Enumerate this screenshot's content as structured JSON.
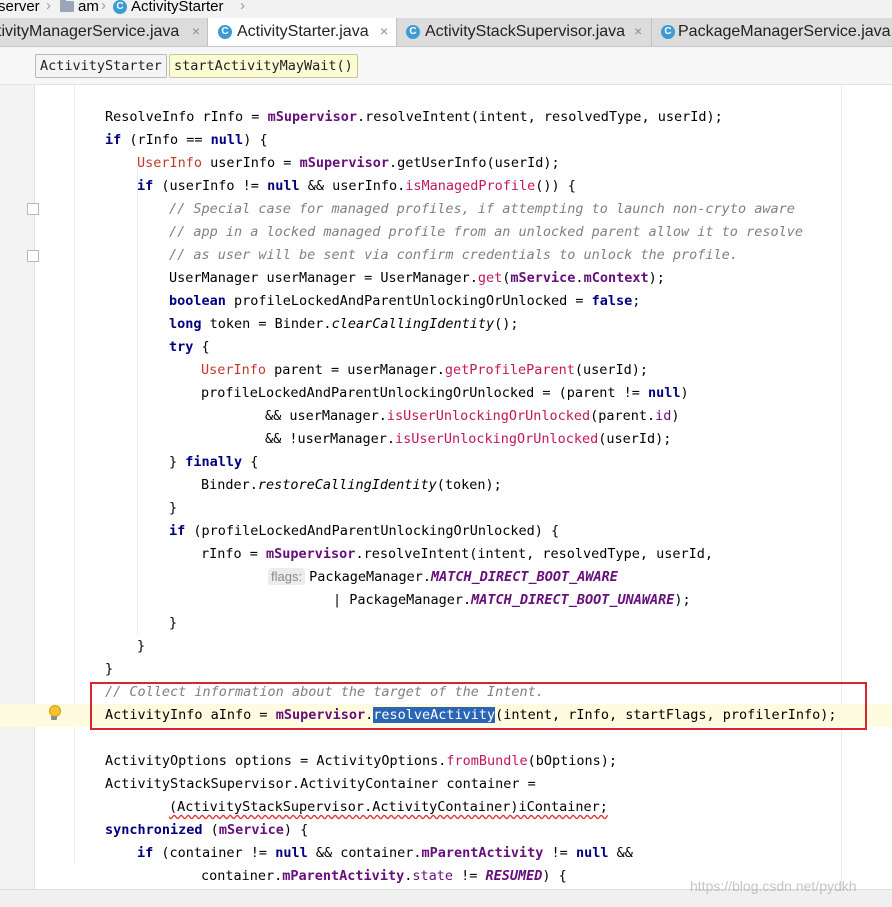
{
  "breadcrumbs": [
    "server",
    "am",
    "ActivityStarter"
  ],
  "tabs": [
    {
      "label": "tivityManagerService.java",
      "close": "×"
    },
    {
      "label": "ActivityStarter.java",
      "close": "×",
      "active": true
    },
    {
      "label": "ActivityStackSupervisor.java",
      "close": "×"
    },
    {
      "label": "PackageManagerService.java",
      "close": "×"
    }
  ],
  "nav": {
    "class_name": "ActivityStarter",
    "method_name": "startActivityMayWait()"
  },
  "code": {
    "l1": {
      "a": "ResolveInfo rInfo = ",
      "b": "mSupervisor",
      "c": ".resolveIntent(intent, resolvedType, userId);"
    },
    "l2": {
      "kw1": "if",
      "a": " (rInfo == ",
      "kw2": "null",
      "b": ") {"
    },
    "l3": {
      "cls": "UserInfo",
      "a": " userInfo = ",
      "f": "mSupervisor",
      "b": ".getUserInfo(userId);"
    },
    "l4": {
      "kw1": "if",
      "a": " (userInfo != ",
      "kw2": "null",
      "b": " && userInfo.",
      "m": "isManagedProfile",
      "c": "()) {"
    },
    "l5": "// Special case for managed profiles, if attempting to launch non-cryto aware",
    "l6": "// app in a locked managed profile from an unlocked parent allow it to resolve",
    "l7": "// as user will be sent via confirm credentials to unlock the profile.",
    "l8": {
      "a": "UserManager userManager = UserManager.",
      "m": "get",
      "b": "(",
      "f": "mService",
      "c": ".",
      "f2": "mContext",
      "d": ");"
    },
    "l9": {
      "kw": "boolean",
      "a": " profileLockedAndParentUnlockingOrUnlocked = ",
      "kw2": "false",
      "b": ";"
    },
    "l10": {
      "kw": "long",
      "a": " token = Binder.",
      "s": "clearCallingIdentity",
      "b": "();"
    },
    "l11": {
      "kw": "try",
      "a": " {"
    },
    "l12": {
      "cls": "UserInfo",
      "a": " parent = userManager.",
      "m": "getProfileParent",
      "b": "(userId);"
    },
    "l13": {
      "a": "profileLockedAndParentUnlockingOrUnlocked = (parent != ",
      "kw": "null",
      "b": ")"
    },
    "l14": {
      "a": "&& userManager.",
      "m": "isUserUnlockingOrUnlocked",
      "b": "(parent.",
      "f": "id",
      "c": ")"
    },
    "l15": {
      "a": "&& !userManager.",
      "m": "isUserUnlockingOrUnlocked",
      "b": "(userId);"
    },
    "l16": {
      "a": "} ",
      "kw": "finally",
      "b": " {"
    },
    "l17": {
      "a": "Binder.",
      "s": "restoreCallingIdentity",
      "b": "(token);"
    },
    "l18": "}",
    "l19": {
      "kw": "if",
      "a": " (profileLockedAndParentUnlockingOrUnlocked) {"
    },
    "l20": {
      "a": "rInfo = ",
      "f": "mSupervisor",
      "b": ".resolveIntent(intent, resolvedType, userId,"
    },
    "l21": {
      "hint": "flags:",
      "a": "PackageManager.",
      "c": "MATCH_DIRECT_BOOT_AWARE"
    },
    "l22": {
      "a": "| PackageManager.",
      "c": "MATCH_DIRECT_BOOT_UNAWARE",
      "b": ");"
    },
    "l23": "}",
    "l24": "}",
    "l25": "}",
    "l26": "// Collect information about the target of the Intent.",
    "l27": {
      "a": "ActivityInfo aInfo = ",
      "f": "mSupervisor",
      "b": ".",
      "sel": "resolveActivity",
      "c": "(intent, rInfo, startFlags, profilerInfo);"
    },
    "l28": {
      "a": "ActivityOptions options = ActivityOptions.",
      "m": "fromBundle",
      "b": "(bOptions);"
    },
    "l29": "ActivityStackSupervisor.ActivityContainer container =",
    "l30": "(ActivityStackSupervisor.ActivityContainer)iContainer;",
    "l31": {
      "kw": "synchronized",
      "a": " (",
      "f": "mService",
      "b": ") {"
    },
    "l32": {
      "kw": "if",
      "a": " (container != ",
      "kw2": "null",
      "b": " && container.",
      "f": "mParentActivity",
      "c": " != ",
      "kw3": "null",
      "d": " &&"
    },
    "l33": {
      "a": "container.",
      "f": "mParentActivity",
      "b": ".",
      "st": "state",
      "c": " != ",
      "cst": "RESUMED",
      "d": ") {"
    }
  },
  "watermark": "https://blog.csdn.net/pydkh",
  "colors": {
    "keyword": "#000080",
    "field": "#660e7a",
    "comment": "#808080",
    "class_ref": "#c0392b",
    "method_ref": "#c2185b",
    "selection": "#2a66b5",
    "callout": "#d9262c",
    "line_highlight": "#fffbe0"
  }
}
